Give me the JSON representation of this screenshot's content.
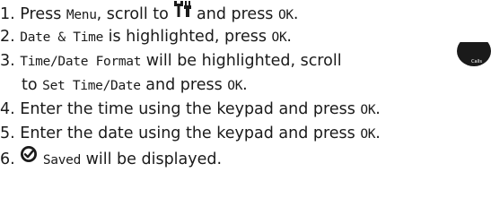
{
  "steps": [
    {
      "number": "1.",
      "t1": "Press ",
      "lcd1": "Menu",
      "t2": ", scroll to ",
      "t3": " and press ",
      "lcd2": "OK",
      "t4": ".",
      "icon": "tools-icon"
    },
    {
      "number": "2.",
      "lcd1": "Date & Time",
      "t1": " is highlighted, press ",
      "lcd2": "OK",
      "t2": "."
    },
    {
      "number": "3.",
      "lcd1": "Time/Date Format",
      "t1": " will be highlighted, scroll ",
      "icon": "calls-button-icon",
      "icon_label": "Calls"
    },
    {
      "cont_t1": "to ",
      "cont_lcd1": "Set Time/Date",
      "cont_t2": " and press ",
      "cont_lcd2": "OK",
      "cont_t3": "."
    },
    {
      "number": "4.",
      "t1": "Enter the time using the keypad and press ",
      "lcd1": "OK",
      "t2": "."
    },
    {
      "number": "5.",
      "t1": "Enter the date using the keypad and press ",
      "lcd1": "OK",
      "t2": "."
    },
    {
      "number": "6.",
      "icon": "saved-check-icon",
      "lcd1": "Saved",
      "t1": " will be displayed."
    }
  ],
  "colors": {
    "text": "#1a1a1a",
    "icon": "#1a1a1a"
  }
}
